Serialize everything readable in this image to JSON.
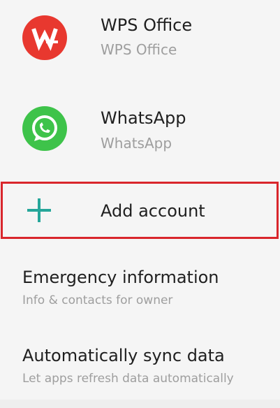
{
  "accounts": [
    {
      "name": "WPS Office",
      "subtitle": "WPS Office",
      "icon": "wps-office-icon",
      "icon_color": "#e8382f"
    },
    {
      "name": "WhatsApp",
      "subtitle": "WhatsApp",
      "icon": "whatsapp-icon",
      "icon_color": "#3ec34a"
    }
  ],
  "add_account": {
    "label": "Add account",
    "icon": "plus-icon",
    "icon_color": "#26a69a",
    "highlight_color": "#d9262c"
  },
  "settings": [
    {
      "title": "Emergency information",
      "subtitle": "Info & contacts for owner"
    },
    {
      "title": "Automatically sync data",
      "subtitle": "Let apps refresh data automatically"
    }
  ]
}
